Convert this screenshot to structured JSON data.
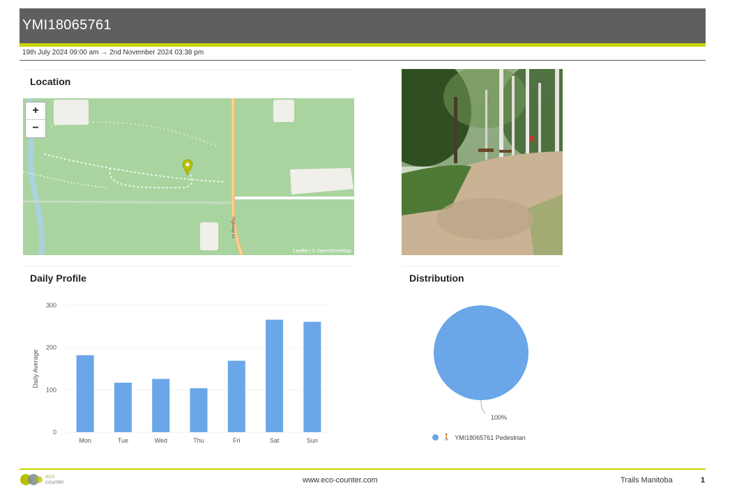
{
  "header": {
    "title": "YMI18065761",
    "date_range": "19th July 2024 09:00 am  →  2nd November 2024 03:38 pm"
  },
  "location": {
    "title": "Location",
    "zoom_in": "+",
    "zoom_out": "−",
    "road_label": "Highway 11",
    "attribution": "Leaflet | © OpenStreetMap"
  },
  "daily_profile": {
    "title": "Daily Profile"
  },
  "distribution": {
    "title": "Distribution",
    "slice_label": "100%",
    "legend_label": "YMI18065761 Pedestrian"
  },
  "chart_data": [
    {
      "type": "bar",
      "categories": [
        "Mon",
        "Tue",
        "Wed",
        "Thu",
        "Fri",
        "Sat",
        "Sun"
      ],
      "values": [
        182,
        117,
        126,
        104,
        169,
        266,
        261
      ],
      "ylabel": "Daily Average",
      "xlabel": "",
      "ylim": [
        0,
        300
      ],
      "yticks": [
        0,
        100,
        200,
        300
      ],
      "color": "#6aa6e8",
      "grid": true
    },
    {
      "type": "pie",
      "labels": [
        "YMI18065761 Pedestrian"
      ],
      "values": [
        100
      ],
      "color": "#6aa6e8"
    }
  ],
  "footer": {
    "logo_text_1": "eco",
    "logo_text_2": "counter",
    "url": "www.eco-counter.com",
    "organization": "Trails Manitoba",
    "page_number": "1"
  },
  "colors": {
    "header_bg": "#5f5f5f",
    "accent": "#c8d400",
    "bar": "#6aa6e8",
    "map_green": "#a9d4a0"
  }
}
